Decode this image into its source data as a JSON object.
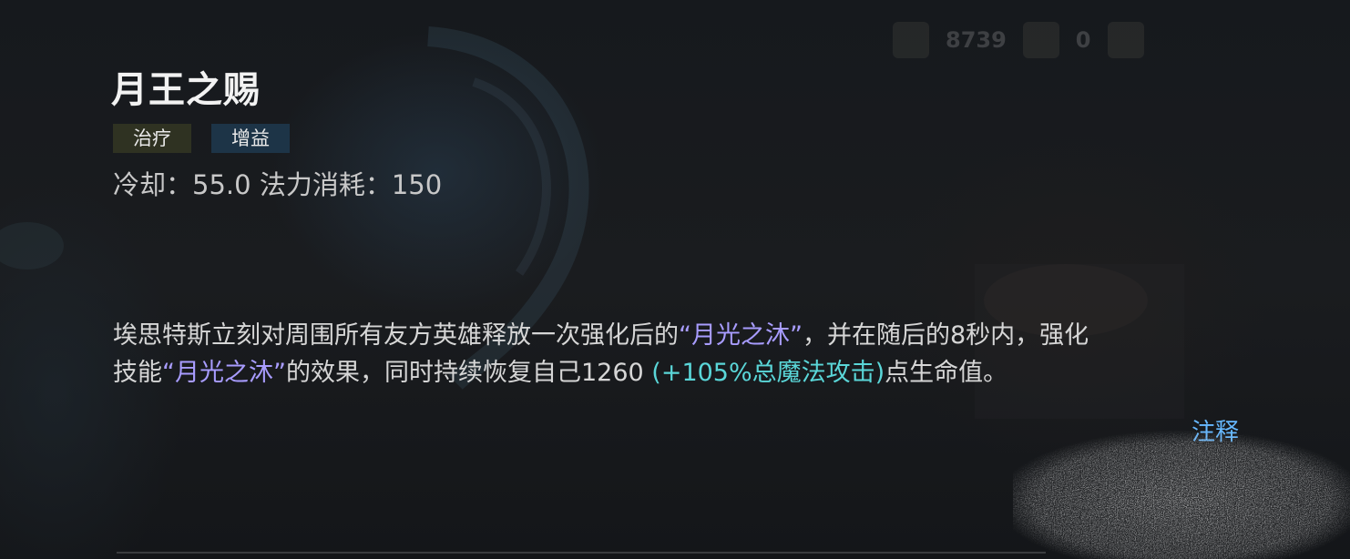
{
  "hud": {
    "value_1": "8739",
    "value_2": "0"
  },
  "skill": {
    "name": "月王之赐",
    "tags": [
      {
        "label": "治疗",
        "color": "#2f3222"
      },
      {
        "label": "增益",
        "color": "#1d3447"
      }
    ],
    "cooldown_label": "冷却：",
    "cooldown_value": "55.0",
    "mana_label": "法力消耗：",
    "mana_value": "150",
    "description": {
      "line1_a": "埃思特斯立刻对周围所有友方英雄释放一次强化后的",
      "line1_highlight": "“月光之沐”",
      "line1_b": "，并在随后的8秒内，强化",
      "line2_a": "技能",
      "line2_highlight": "“月光之沐”",
      "line2_b": "的效果，同时持续恢复自己1260 ",
      "line2_scaling": "(+105%总魔法攻击)",
      "line2_c": "点生命值。"
    },
    "note_link": "注释"
  },
  "colors": {
    "skill_highlight": "#a89cff",
    "scaling": "#5ad6d8",
    "link": "#66b8ff"
  }
}
